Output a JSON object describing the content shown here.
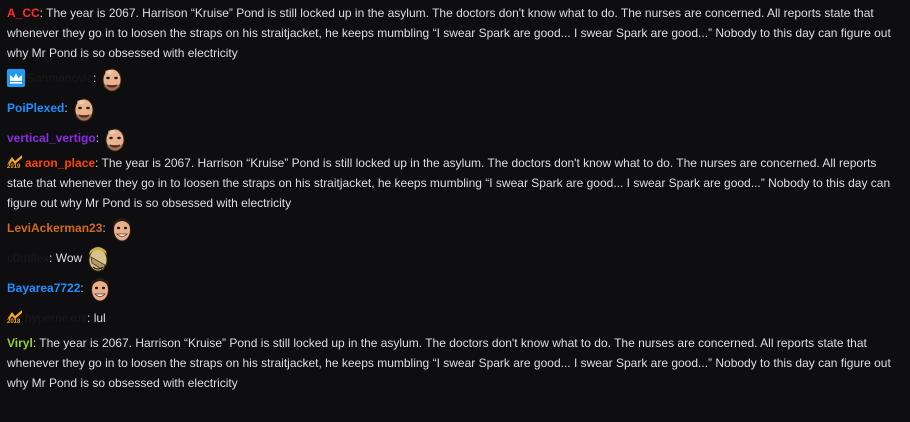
{
  "colors": {
    "background": "#0e0e10",
    "text": "#dedee3",
    "a_cc": "#ff2b2b",
    "sanmanovic": "#1a1a1e",
    "poiplexed": "#1e90ff",
    "vertical_vertigo": "#8a2be2",
    "aaron_place": "#ff4500",
    "leviackerman23": "#d2691e",
    "c0rnflex": "#1a1a1e",
    "bayarea7722": "#1e90ff",
    "hypernexus": "#1a1a1e",
    "viryl": "#9acd32"
  },
  "messages": [
    {
      "username": "A_CC",
      "text": "The year is 2067. Harrison “Kruise” Pond is still locked up in the asylum. The doctors don't know what to do. The nurses are concerned. All reports state that whenever they go in to loosen the straps on his straitjacket, he keeps mumbling “I swear Spark are good... I swear Spark are good...” Nobody to this day can figure out why Mr Pond is so obsessed with electricity"
    },
    {
      "username": "Sanmanovic",
      "badge": "crown-badge-icon"
    },
    {
      "username": "PoiPlexed"
    },
    {
      "username": "vertical_vertigo"
    },
    {
      "username": "aaron_place",
      "badge": "2019-badge-icon",
      "badge_year": "2019",
      "text": "The year is 2067. Harrison “Kruise” Pond is still locked up in the asylum. The doctors don't know what to do. The nurses are concerned. All reports state that whenever they go in to loosen the straps on his straitjacket, he keeps mumbling “I swear Spark are good... I swear Spark are good...” Nobody to this day can figure out why Mr Pond is so obsessed with electricity"
    },
    {
      "username": "LeviAckerman23"
    },
    {
      "username": "c0rnflex",
      "text": "Wow"
    },
    {
      "username": "Bayarea7722"
    },
    {
      "username": "hypernexus",
      "badge": "2018-badge-icon",
      "badge_year": "2018",
      "text": "lul"
    },
    {
      "username": "Viryl",
      "text": "The year is 2067. Harrison “Kruise” Pond is still locked up in the asylum. The doctors don't know what to do. The nurses are concerned. All reports state that whenever they go in to loosen the straps on his straitjacket, he keeps mumbling “I swear Spark are good... I swear Spark are good...” Nobody to this day can figure out why Mr Pond is so obsessed with electricity"
    }
  ]
}
